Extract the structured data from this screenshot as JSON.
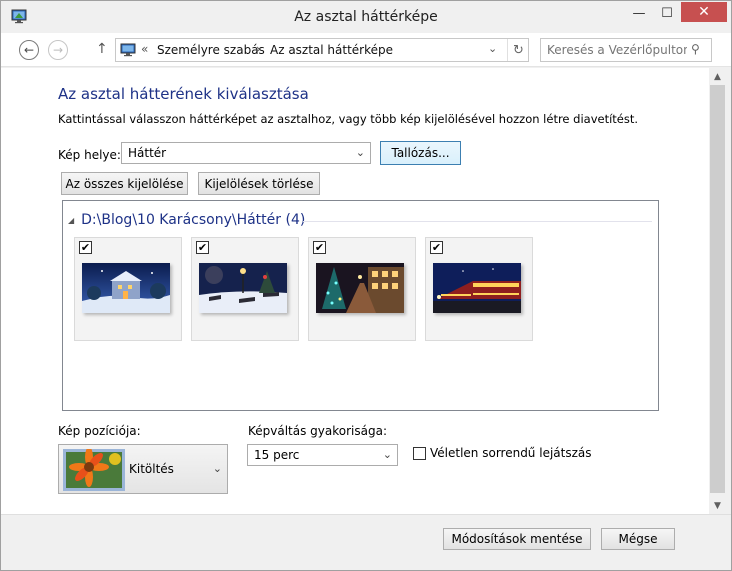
{
  "window": {
    "title": "Az asztal háttérképe",
    "minimize_glyph": "—",
    "maximize_glyph": "☐",
    "close_glyph": "✕"
  },
  "navbar": {
    "back_glyph": "←",
    "forward_glyph": "→",
    "up_glyph": "↑",
    "crumb_prefix": "«",
    "crumbs": [
      "Személyre szabás",
      "Az asztal háttérképe"
    ],
    "crumb_sep": "›",
    "dropdown_glyph": "⌄",
    "refresh_glyph": "↻",
    "search_placeholder": "Keresés a Vezérlőpulton",
    "search_glyph": "⚲"
  },
  "main": {
    "heading": "Az asztal hátterének kiválasztása",
    "description": "Kattintással válasszon háttérképet az asztalhoz, vagy több kép kijelölésével hozzon létre diavetítést.",
    "location_label": "Kép helye:",
    "location_value": "Háttér",
    "browse_label": "Tallózás...",
    "select_all_label": "Az összes kijelölése",
    "clear_selection_label": "Kijelölések törlése",
    "group_collapse_glyph": "◢",
    "group_title": "D:\\Blog\\10 Karácsony\\Háttér (4)",
    "check_glyph": "✔",
    "images": [
      {
        "name": "snowy-castle",
        "checked": true
      },
      {
        "name": "snowy-park-benches",
        "checked": true
      },
      {
        "name": "christmas-street-lights",
        "checked": true
      },
      {
        "name": "christmas-train",
        "checked": true
      }
    ],
    "position_label": "Kép pozíciója:",
    "position_value": "Kitöltés",
    "interval_label": "Képváltás gyakorisága:",
    "interval_value": "15 perc",
    "shuffle_label": "Véletlen sorrendű lejátszás",
    "shuffle_checked": false,
    "dropdown_glyph": "⌄"
  },
  "scrollbar": {
    "up_glyph": "▲",
    "down_glyph": "▼"
  },
  "footer": {
    "save_label": "Módosítások mentése",
    "cancel_label": "Mégse"
  },
  "colors": {
    "heading": "#1e3287",
    "close_button": "#c75050"
  }
}
